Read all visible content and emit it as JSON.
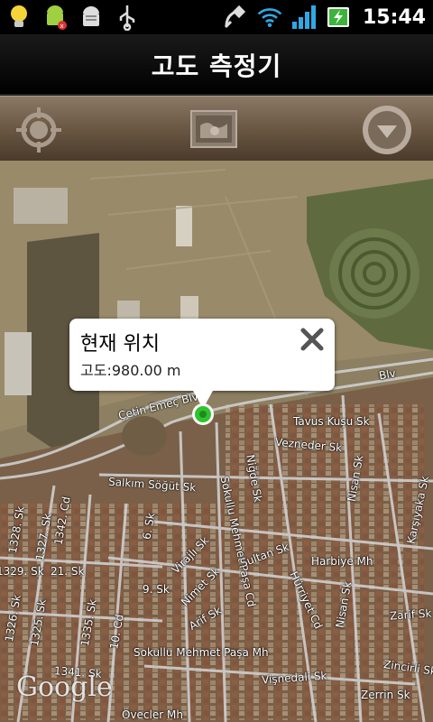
{
  "statusbar": {
    "time": "15:44",
    "icons": [
      "lightbulb-icon",
      "android-debug-icon",
      "android-icon",
      "usb-icon",
      "gps-icon",
      "wifi-icon",
      "signal-icon",
      "battery-charging-icon"
    ]
  },
  "titlebar": {
    "title": "고도 측정기"
  },
  "toolbar": {
    "buttons": [
      "my-location-icon",
      "map-view-icon",
      "menu-dropdown-icon"
    ]
  },
  "popup": {
    "title": "현재 위치",
    "altitude_text": "고도:980.00 m"
  },
  "map": {
    "logo": "Google",
    "labels": {
      "l1": "Çetin Emeç Blv",
      "l2": "Tavus Kuşu Sk",
      "l3": "Vezneder Sk",
      "l4": "Salkım Söğüt Sk",
      "l5": "Sokullu Mehmet Paşa Cd",
      "l6": "Niğde Sk",
      "l7": "Nisan Sk",
      "l8": "Karşıyaka Sk",
      "l9": "Harbiye Mh",
      "l10": "Zarif Sk",
      "l11": "Sultan Sk",
      "l12": "Hürriyet Cd",
      "l13": "Nimet Sk",
      "l14": "Arif Sk",
      "l15": "Virajlı Sk",
      "l16": "9. Sk",
      "l17": "1342. Cd",
      "l18": "1328. Sk",
      "l19": "1327. Sk",
      "l20": "1329. Sk",
      "l21": "21. Sk",
      "l22": "1326. Sk",
      "l23": "1325. Sk",
      "l24": "1335. Sk",
      "l25": "Sokullu Mehmet Paşa Mh",
      "l26": "1341. Sk",
      "l27": "Övecler Mh",
      "l28": "Vişnedali Sk",
      "l29": "Zincirli Sk",
      "l30": "Zerrin Sk",
      "l31": "Nisan Sk",
      "l32": "Erikli Sk",
      "l33": "6. Sk",
      "l34": "10. Cd",
      "l35": "Kuşu Sk"
    }
  },
  "colors": {
    "marker": "#2ec42e",
    "toolbar": "#6d5a46"
  }
}
